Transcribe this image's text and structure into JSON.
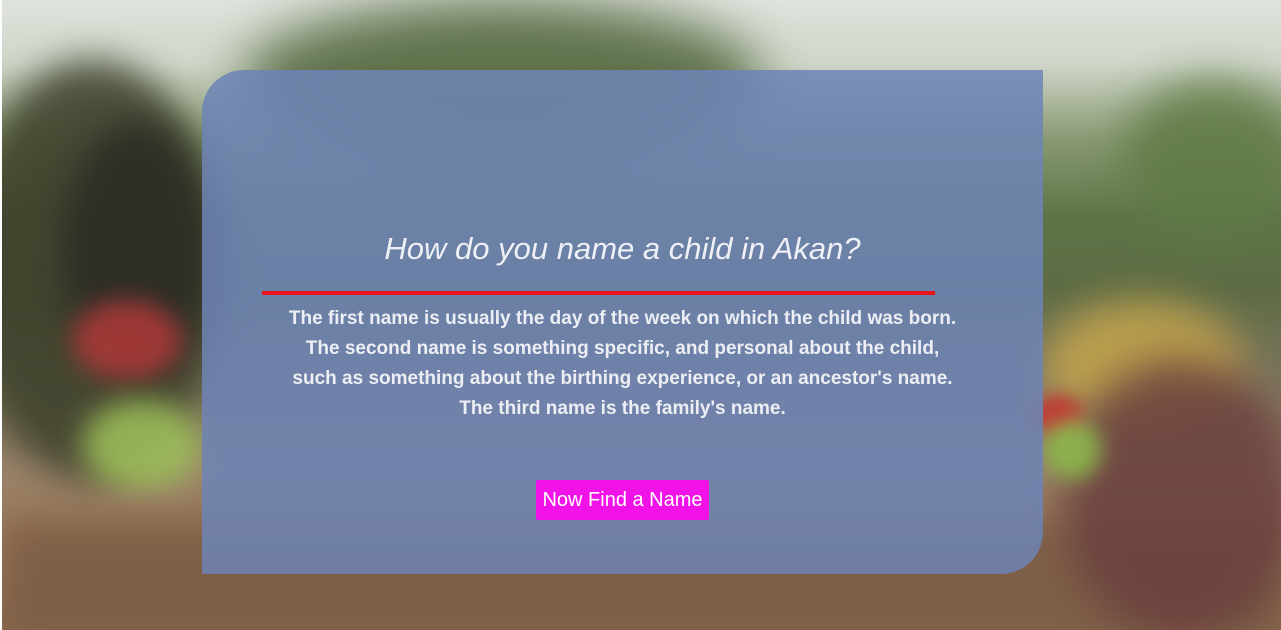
{
  "hero": {
    "background": "photo-of-traditional-dancers"
  },
  "card": {
    "title": "How do you name a child in Akan?",
    "lines": [
      "The first name is usually the day of the week on which the child was born.",
      "The second name is something specific, and personal about the child,",
      "such as something about the birthing experience, or an ancestor's name.",
      "The third name is the family's name."
    ],
    "cta_label": "Now Find a Name"
  },
  "colors": {
    "card_overlay": "#6e83b6",
    "divider": "#e8141c",
    "cta_background": "#f012e6",
    "text": "#eceef4"
  }
}
